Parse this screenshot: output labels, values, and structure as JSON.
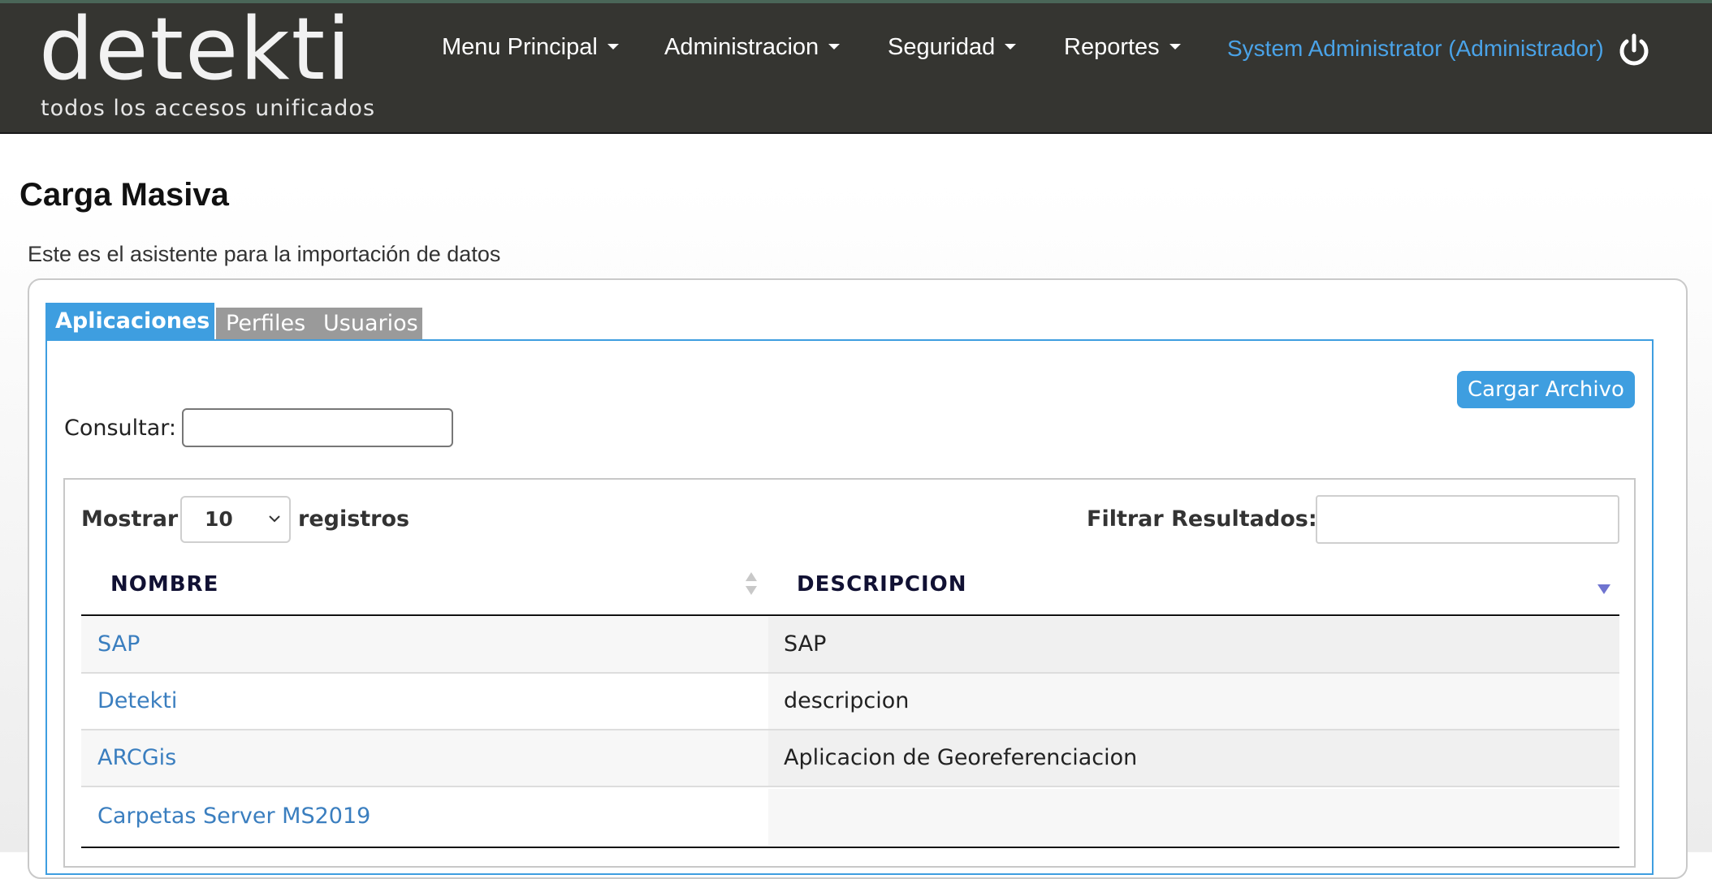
{
  "logo": {
    "word": "detekti",
    "tagline": "todos los accesos unificados"
  },
  "nav": {
    "items": [
      {
        "label": "Menu Principal"
      },
      {
        "label": "Administracion"
      },
      {
        "label": "Seguridad"
      },
      {
        "label": "Reportes"
      }
    ],
    "user": "System Administrator (Administrador)"
  },
  "page": {
    "title": "Carga Masiva",
    "subtitle": "Este es el asistente para la importación de datos"
  },
  "tabs": [
    {
      "label": "Aplicaciones",
      "active": true
    },
    {
      "label": "Perfiles",
      "active": false
    },
    {
      "label": "Usuarios",
      "active": false
    }
  ],
  "toolbar": {
    "upload_label": "Cargar Archivo",
    "consult_label": "Consultar:",
    "consult_value": ""
  },
  "table": {
    "length_prefix": "Mostrar",
    "length_value": "10",
    "length_suffix": "registros",
    "filter_label": "Filtrar Resultados:",
    "filter_value": "",
    "columns": [
      "NOMBRE",
      "DESCRIPCION"
    ],
    "rows": [
      {
        "name": "SAP",
        "description": "SAP"
      },
      {
        "name": "Detekti",
        "description": "descripcion"
      },
      {
        "name": "ARCGis",
        "description": "Aplicacion de Georeferenciacion"
      },
      {
        "name": "Carpetas Server MS2019",
        "description": ""
      }
    ]
  },
  "colors": {
    "accent": "#3e9ee0",
    "topbar": "#353531",
    "link": "#3a7ebf",
    "user_link": "#4aa3e8",
    "tab_inactive": "#9a9a9a"
  }
}
